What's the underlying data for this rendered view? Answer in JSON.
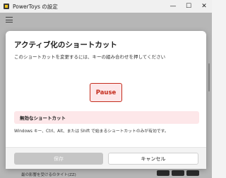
{
  "window": {
    "title": "PowerToys の設定",
    "minimize_glyph": "—",
    "maximize_glyph": "☐",
    "close_glyph": "✕"
  },
  "dialog": {
    "title": "アクティブ化のショートカット",
    "description": "このショートカットを変更するには、キーの組み合わせを押してください",
    "pressed_key": "Pause",
    "error_title": "無効なショートカット",
    "error_detail": "Windows キー、Ctrl、Alt、または Shift で始まるショートカットのみが有効です。",
    "save_label": "保存",
    "cancel_label": "キャンセル"
  },
  "background": {
    "peek_text": "最の影響を受けるのタイト(ZZ)"
  },
  "colors": {
    "accent_error": "#c42b1c",
    "error_background": "#fde7e9"
  }
}
